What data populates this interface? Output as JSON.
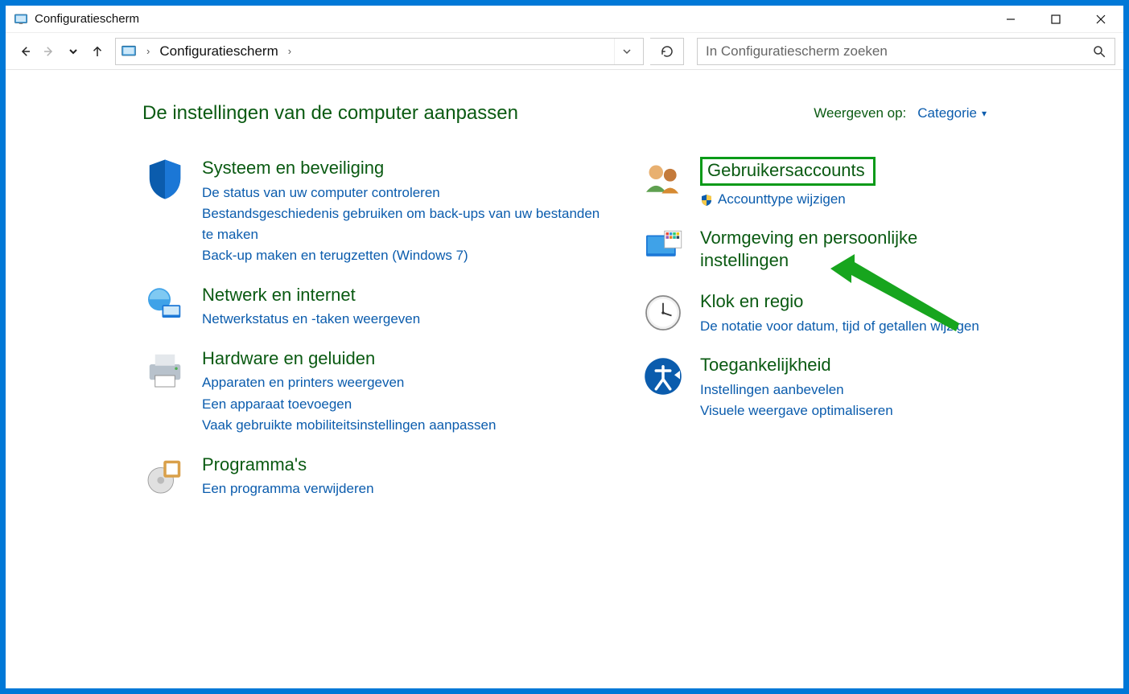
{
  "window": {
    "title": "Configuratiescherm"
  },
  "address": {
    "crumb": "Configuratiescherm"
  },
  "search": {
    "placeholder": "In Configuratiescherm zoeken"
  },
  "heading": "De instellingen van de computer aanpassen",
  "viewBy": {
    "label": "Weergeven op:",
    "value": "Categorie"
  },
  "left": [
    {
      "title": "Systeem en beveiliging",
      "links": [
        "De status van uw computer controleren",
        "Bestandsgeschiedenis gebruiken om back-ups van uw bestanden te maken",
        "Back-up maken en terugzetten (Windows 7)"
      ]
    },
    {
      "title": "Netwerk en internet",
      "links": [
        "Netwerkstatus en -taken weergeven"
      ]
    },
    {
      "title": "Hardware en geluiden",
      "links": [
        "Apparaten en printers weergeven",
        "Een apparaat toevoegen",
        "Vaak gebruikte mobiliteitsinstellingen aanpassen"
      ]
    },
    {
      "title": "Programma's",
      "links": [
        "Een programma verwijderen"
      ]
    }
  ],
  "right": [
    {
      "title": "Gebruikersaccounts",
      "links": [
        "Accounttype wijzigen"
      ],
      "shieldFirst": true,
      "highlight": true
    },
    {
      "title": "Vormgeving en persoonlijke instellingen",
      "links": []
    },
    {
      "title": "Klok en regio",
      "links": [
        "De notatie voor datum, tijd of getallen wijzigen"
      ]
    },
    {
      "title": "Toegankelijkheid",
      "links": [
        "Instellingen aanbevelen",
        "Visuele weergave optimaliseren"
      ]
    }
  ]
}
